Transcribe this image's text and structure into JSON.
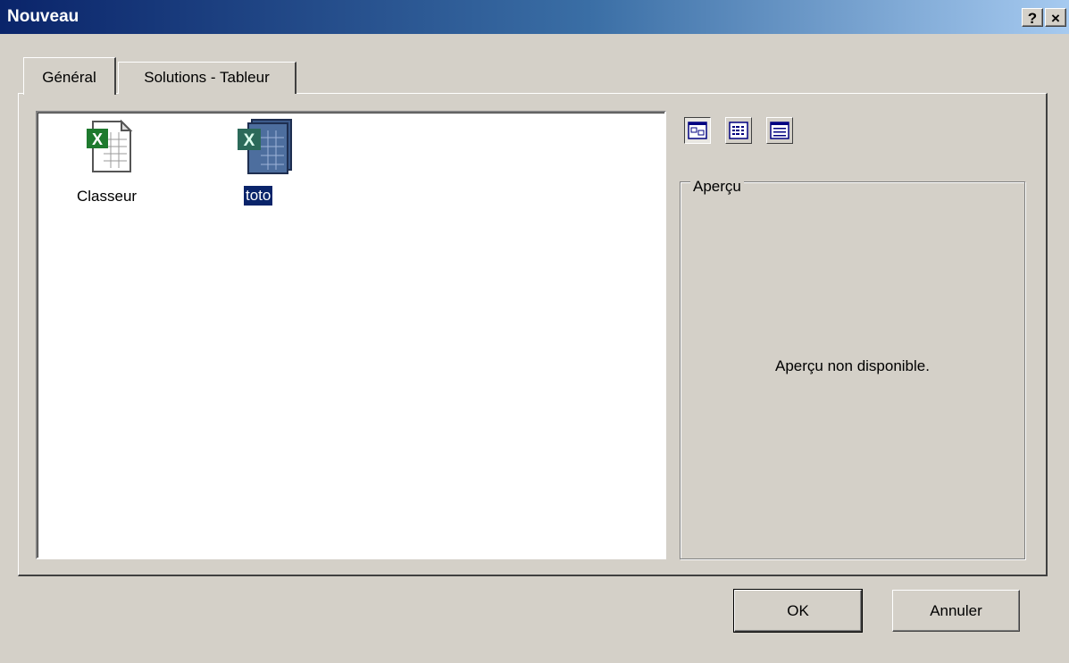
{
  "window": {
    "title": "Nouveau",
    "help_label": "?",
    "close_label": "×"
  },
  "tabs": [
    {
      "label": "Général",
      "active": true
    },
    {
      "label": "Solutions - Tableur",
      "active": false
    }
  ],
  "files": [
    {
      "label": "Classeur",
      "icon": "excel-workbook-icon",
      "selected": false
    },
    {
      "label": "toto",
      "icon": "excel-template-icon",
      "selected": true
    }
  ],
  "view_buttons": [
    {
      "name": "large-icons-view-icon",
      "pressed": true
    },
    {
      "name": "list-view-icon",
      "pressed": false
    },
    {
      "name": "details-view-icon",
      "pressed": false
    }
  ],
  "preview": {
    "legend": "Aperçu",
    "message": "Aperçu non disponible."
  },
  "buttons": {
    "ok_label": "OK",
    "cancel_label": "Annuler"
  },
  "colors": {
    "title_gradient_start": "#0a246a",
    "title_gradient_end": "#a6caf0",
    "face": "#d4d0c8",
    "selection": "#0a246a",
    "excel_green": "#1e7a2e"
  }
}
